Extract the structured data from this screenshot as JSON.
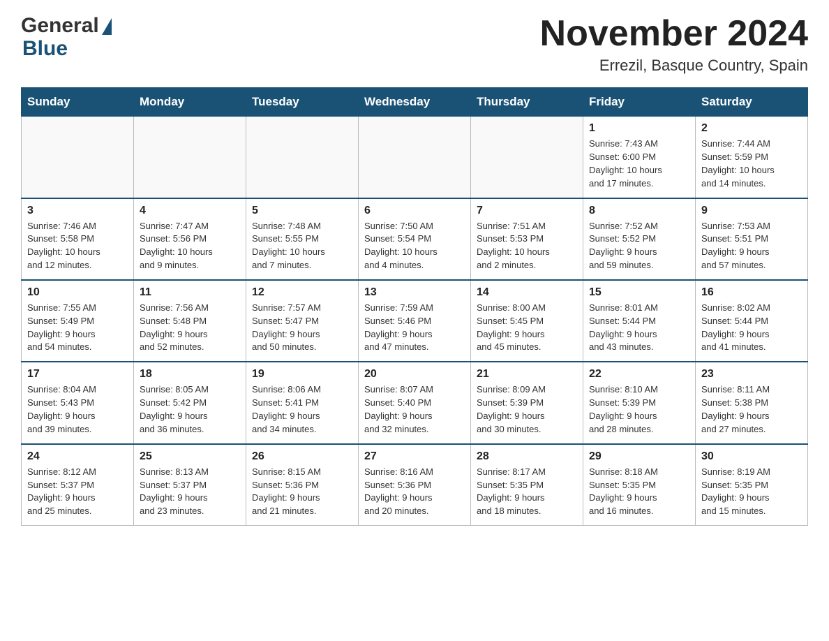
{
  "header": {
    "logo_general": "General",
    "logo_blue": "Blue",
    "month_title": "November 2024",
    "location": "Errezil, Basque Country, Spain"
  },
  "weekdays": [
    "Sunday",
    "Monday",
    "Tuesday",
    "Wednesday",
    "Thursday",
    "Friday",
    "Saturday"
  ],
  "weeks": [
    [
      {
        "day": "",
        "info": ""
      },
      {
        "day": "",
        "info": ""
      },
      {
        "day": "",
        "info": ""
      },
      {
        "day": "",
        "info": ""
      },
      {
        "day": "",
        "info": ""
      },
      {
        "day": "1",
        "info": "Sunrise: 7:43 AM\nSunset: 6:00 PM\nDaylight: 10 hours\nand 17 minutes."
      },
      {
        "day": "2",
        "info": "Sunrise: 7:44 AM\nSunset: 5:59 PM\nDaylight: 10 hours\nand 14 minutes."
      }
    ],
    [
      {
        "day": "3",
        "info": "Sunrise: 7:46 AM\nSunset: 5:58 PM\nDaylight: 10 hours\nand 12 minutes."
      },
      {
        "day": "4",
        "info": "Sunrise: 7:47 AM\nSunset: 5:56 PM\nDaylight: 10 hours\nand 9 minutes."
      },
      {
        "day": "5",
        "info": "Sunrise: 7:48 AM\nSunset: 5:55 PM\nDaylight: 10 hours\nand 7 minutes."
      },
      {
        "day": "6",
        "info": "Sunrise: 7:50 AM\nSunset: 5:54 PM\nDaylight: 10 hours\nand 4 minutes."
      },
      {
        "day": "7",
        "info": "Sunrise: 7:51 AM\nSunset: 5:53 PM\nDaylight: 10 hours\nand 2 minutes."
      },
      {
        "day": "8",
        "info": "Sunrise: 7:52 AM\nSunset: 5:52 PM\nDaylight: 9 hours\nand 59 minutes."
      },
      {
        "day": "9",
        "info": "Sunrise: 7:53 AM\nSunset: 5:51 PM\nDaylight: 9 hours\nand 57 minutes."
      }
    ],
    [
      {
        "day": "10",
        "info": "Sunrise: 7:55 AM\nSunset: 5:49 PM\nDaylight: 9 hours\nand 54 minutes."
      },
      {
        "day": "11",
        "info": "Sunrise: 7:56 AM\nSunset: 5:48 PM\nDaylight: 9 hours\nand 52 minutes."
      },
      {
        "day": "12",
        "info": "Sunrise: 7:57 AM\nSunset: 5:47 PM\nDaylight: 9 hours\nand 50 minutes."
      },
      {
        "day": "13",
        "info": "Sunrise: 7:59 AM\nSunset: 5:46 PM\nDaylight: 9 hours\nand 47 minutes."
      },
      {
        "day": "14",
        "info": "Sunrise: 8:00 AM\nSunset: 5:45 PM\nDaylight: 9 hours\nand 45 minutes."
      },
      {
        "day": "15",
        "info": "Sunrise: 8:01 AM\nSunset: 5:44 PM\nDaylight: 9 hours\nand 43 minutes."
      },
      {
        "day": "16",
        "info": "Sunrise: 8:02 AM\nSunset: 5:44 PM\nDaylight: 9 hours\nand 41 minutes."
      }
    ],
    [
      {
        "day": "17",
        "info": "Sunrise: 8:04 AM\nSunset: 5:43 PM\nDaylight: 9 hours\nand 39 minutes."
      },
      {
        "day": "18",
        "info": "Sunrise: 8:05 AM\nSunset: 5:42 PM\nDaylight: 9 hours\nand 36 minutes."
      },
      {
        "day": "19",
        "info": "Sunrise: 8:06 AM\nSunset: 5:41 PM\nDaylight: 9 hours\nand 34 minutes."
      },
      {
        "day": "20",
        "info": "Sunrise: 8:07 AM\nSunset: 5:40 PM\nDaylight: 9 hours\nand 32 minutes."
      },
      {
        "day": "21",
        "info": "Sunrise: 8:09 AM\nSunset: 5:39 PM\nDaylight: 9 hours\nand 30 minutes."
      },
      {
        "day": "22",
        "info": "Sunrise: 8:10 AM\nSunset: 5:39 PM\nDaylight: 9 hours\nand 28 minutes."
      },
      {
        "day": "23",
        "info": "Sunrise: 8:11 AM\nSunset: 5:38 PM\nDaylight: 9 hours\nand 27 minutes."
      }
    ],
    [
      {
        "day": "24",
        "info": "Sunrise: 8:12 AM\nSunset: 5:37 PM\nDaylight: 9 hours\nand 25 minutes."
      },
      {
        "day": "25",
        "info": "Sunrise: 8:13 AM\nSunset: 5:37 PM\nDaylight: 9 hours\nand 23 minutes."
      },
      {
        "day": "26",
        "info": "Sunrise: 8:15 AM\nSunset: 5:36 PM\nDaylight: 9 hours\nand 21 minutes."
      },
      {
        "day": "27",
        "info": "Sunrise: 8:16 AM\nSunset: 5:36 PM\nDaylight: 9 hours\nand 20 minutes."
      },
      {
        "day": "28",
        "info": "Sunrise: 8:17 AM\nSunset: 5:35 PM\nDaylight: 9 hours\nand 18 minutes."
      },
      {
        "day": "29",
        "info": "Sunrise: 8:18 AM\nSunset: 5:35 PM\nDaylight: 9 hours\nand 16 minutes."
      },
      {
        "day": "30",
        "info": "Sunrise: 8:19 AM\nSunset: 5:35 PM\nDaylight: 9 hours\nand 15 minutes."
      }
    ]
  ]
}
